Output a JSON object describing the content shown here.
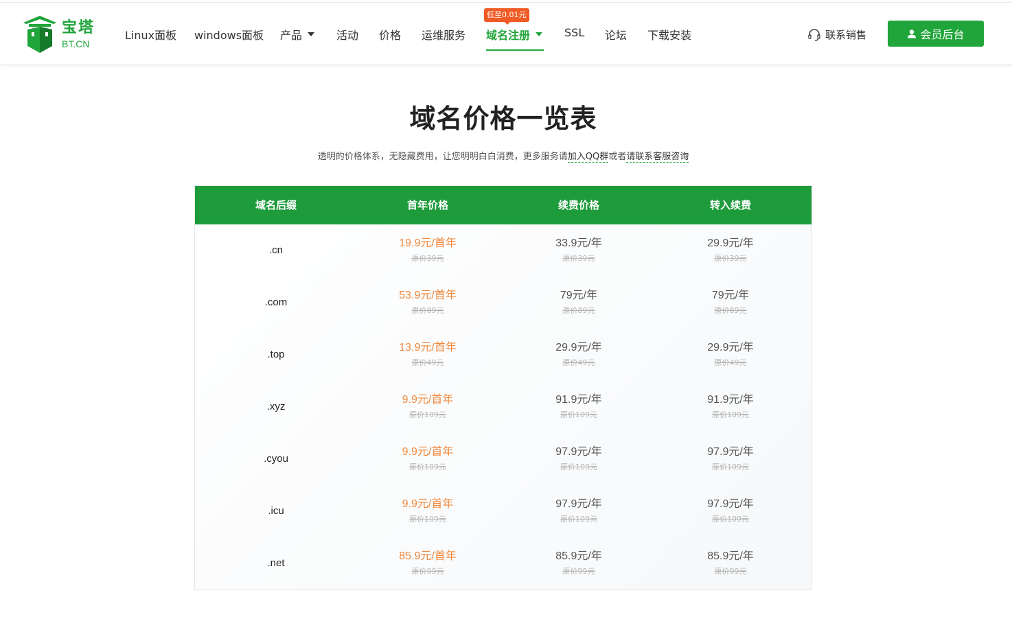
{
  "header": {
    "logo": {
      "cn": "宝塔",
      "en": "BT.CN"
    },
    "nav": [
      {
        "label": "Linux面板",
        "dropdown": false
      },
      {
        "label": "windows面板",
        "dropdown": false
      },
      {
        "label": "产品",
        "dropdown": true
      },
      {
        "label": "活动",
        "dropdown": false
      },
      {
        "label": "价格",
        "dropdown": false
      },
      {
        "label": "运维服务",
        "dropdown": false
      },
      {
        "label": "域名注册",
        "dropdown": true,
        "active": true,
        "badge": "低至0.01元"
      },
      {
        "label": "SSL",
        "dropdown": false
      },
      {
        "label": "论坛",
        "dropdown": false
      },
      {
        "label": "下载安装",
        "dropdown": false
      }
    ],
    "contact_label": "联系销售",
    "member_label": "会员后台"
  },
  "page": {
    "title": "域名价格一览表",
    "subtitle_prefix": "透明的价格体系，无隐藏费用，让您明明白白消费，更多服务请",
    "subtitle_link1": "加入QQ群",
    "subtitle_middle": "或者",
    "subtitle_link2": "请联系客服咨询"
  },
  "table": {
    "headers": [
      "域名后缀",
      "首年价格",
      "续费价格",
      "转入续费"
    ],
    "rows": [
      {
        "suffix": ".cn",
        "first": "19.9元/首年",
        "first_orig": "原价39元",
        "renew": "33.9元/年",
        "renew_orig": "原价39元",
        "transfer": "29.9元/年",
        "transfer_orig": "原价39元"
      },
      {
        "suffix": ".com",
        "first": "53.9元/首年",
        "first_orig": "原价89元",
        "renew": "79元/年",
        "renew_orig": "原价89元",
        "transfer": "79元/年",
        "transfer_orig": "原价89元"
      },
      {
        "suffix": ".top",
        "first": "13.9元/首年",
        "first_orig": "原价49元",
        "renew": "29.9元/年",
        "renew_orig": "原价49元",
        "transfer": "29.9元/年",
        "transfer_orig": "原价49元"
      },
      {
        "suffix": ".xyz",
        "first": "9.9元/首年",
        "first_orig": "原价109元",
        "renew": "91.9元/年",
        "renew_orig": "原价109元",
        "transfer": "91.9元/年",
        "transfer_orig": "原价109元"
      },
      {
        "suffix": ".cyou",
        "first": "9.9元/首年",
        "first_orig": "原价109元",
        "renew": "97.9元/年",
        "renew_orig": "原价109元",
        "transfer": "97.9元/年",
        "transfer_orig": "原价109元"
      },
      {
        "suffix": ".icu",
        "first": "9.9元/首年",
        "first_orig": "原价109元",
        "renew": "97.9元/年",
        "renew_orig": "原价109元",
        "transfer": "97.9元/年",
        "transfer_orig": "原价109元"
      },
      {
        "suffix": ".net",
        "first": "85.9元/首年",
        "first_orig": "原价99元",
        "renew": "85.9元/年",
        "renew_orig": "原价99元",
        "transfer": "85.9元/年",
        "transfer_orig": "原价99元"
      }
    ]
  },
  "colors": {
    "brand_green": "#20a53a",
    "header_green": "#1e9b3b",
    "promo_orange": "#f05a24",
    "first_price_orange": "#f0883b"
  },
  "icons": {
    "logo": "fortress-logo-icon",
    "contact": "headset-icon",
    "member": "user-icon",
    "dropdown": "caret-down-icon"
  }
}
